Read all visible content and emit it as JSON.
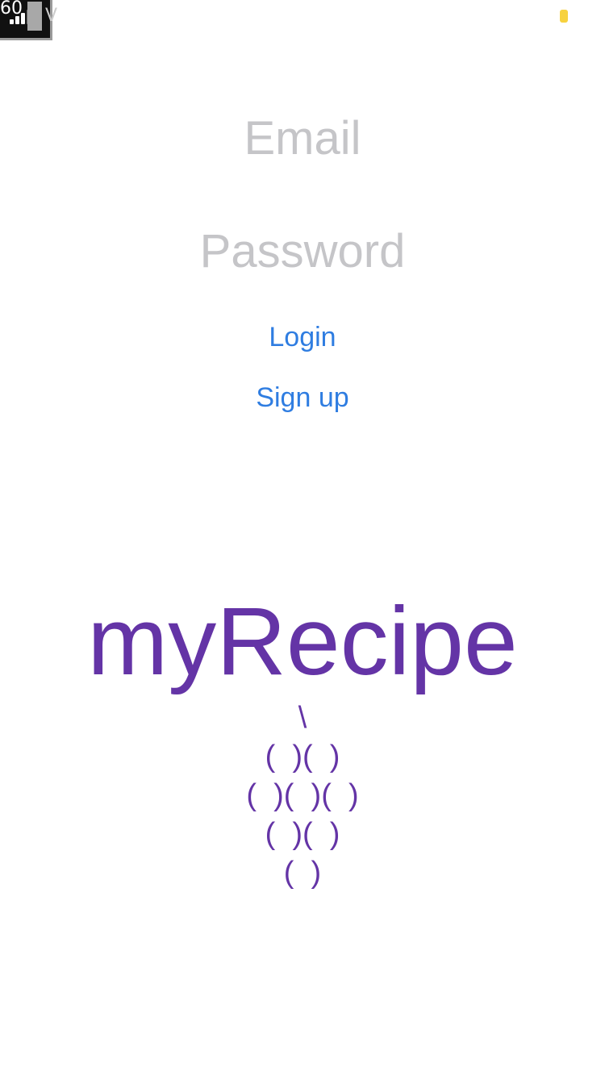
{
  "status_bar": {
    "fps": "60",
    "carrier": "V",
    "battery_color": "#f7d23f"
  },
  "login_form": {
    "email_placeholder": "Email",
    "password_placeholder": "Password",
    "login_label": "Login",
    "signup_label": "Sign up"
  },
  "logo": {
    "title": "myRecipe",
    "grapes": [
      "\\",
      "(  )(  )",
      "(  )(  )(  )",
      "(  )(  )",
      "(  )"
    ]
  },
  "colors": {
    "accent": "#2f7de1",
    "brand": "#6434a6",
    "placeholder": "#c5c5c8",
    "background": "#ffffff"
  }
}
